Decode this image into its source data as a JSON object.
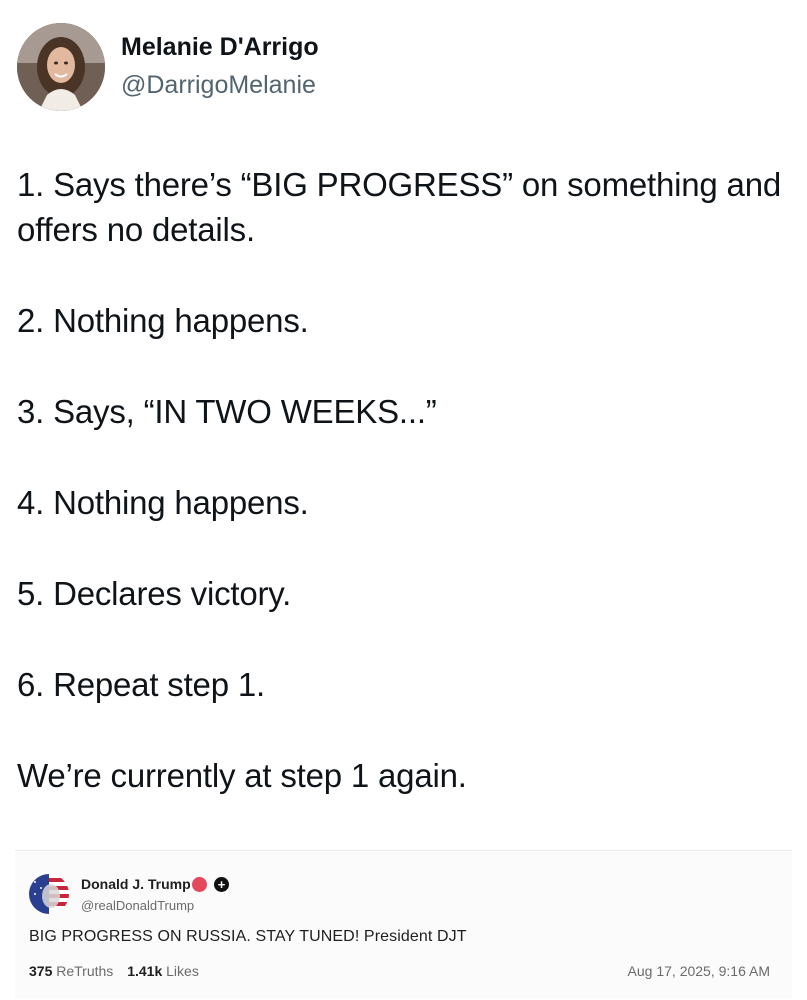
{
  "author": {
    "name": "Melanie D'Arrigo",
    "handle": "@DarrigoMelanie"
  },
  "tweet": {
    "lines": [
      "1. Says there’s “BIG PROGRESS” on something and offers no details.",
      "2. Nothing happens.",
      "3. Says, “IN TWO WEEKS...”",
      "4. Nothing happens.",
      "5. Declares victory.",
      "6. Repeat step 1.",
      "We’re currently at step 1 again."
    ]
  },
  "quoted_post": {
    "author_name": "Donald J. Trump",
    "handle": "@realDonaldTrump",
    "text": "BIG PROGRESS ON RUSSIA. STAY TUNED! President DJT",
    "retruths_count": "375",
    "retruths_label": "ReTruths",
    "likes_count": "1.41k",
    "likes_label": "Likes",
    "timestamp": "Aug 17, 2025, 9:16 AM",
    "verified_badge_icon": "verified-badge-icon",
    "plus_icon": "plus-icon",
    "plus_symbol": "+"
  },
  "colors": {
    "text_primary": "#0f1419",
    "text_secondary": "#536471",
    "badge": "#e3485c"
  }
}
